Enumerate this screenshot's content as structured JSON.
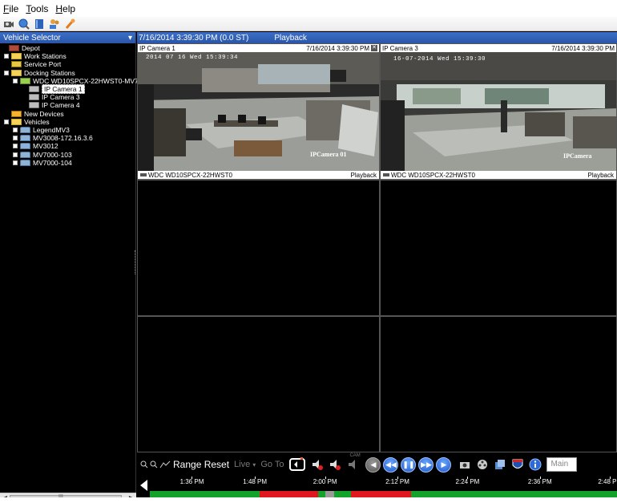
{
  "menu": {
    "items": [
      {
        "label": "File",
        "ul": "F",
        "rest": "ile"
      },
      {
        "label": "Tools",
        "ul": "T",
        "rest": "ools"
      },
      {
        "label": "Help",
        "ul": "H",
        "rest": "elp"
      }
    ]
  },
  "toolbar": {
    "icons": [
      "camera-icon",
      "globe-search-icon",
      "book-icon",
      "users-icon",
      "wrench-icon"
    ]
  },
  "left_panel": {
    "title": "Vehicle Selector",
    "pin": "▾",
    "tree": [
      {
        "label": "Depot",
        "icon": "depot",
        "level": 0,
        "exp": false
      },
      {
        "label": "Work Stations",
        "icon": "folder",
        "level": 1,
        "exp": true
      },
      {
        "label": "Service Port",
        "icon": "port",
        "level": 1,
        "exp": false
      },
      {
        "label": "Docking Stations",
        "icon": "folder",
        "level": 1,
        "exp": true
      },
      {
        "label": "WDC WD10SPCX-22HWST0-MV7",
        "icon": "station",
        "level": 2,
        "exp": true
      },
      {
        "label": "IP Camera 1",
        "icon": "cam",
        "level": 3,
        "exp": false,
        "selected": true
      },
      {
        "label": "IP Camera 3",
        "icon": "cam",
        "level": 3,
        "exp": false
      },
      {
        "label": "IP Camera 4",
        "icon": "cam",
        "level": 3,
        "exp": false
      },
      {
        "label": "New Devices",
        "icon": "newdev",
        "level": 1,
        "exp": false
      },
      {
        "label": "Vehicles",
        "icon": "folder",
        "level": 1,
        "exp": true
      },
      {
        "label": "LegendMV3",
        "icon": "veh",
        "level": 2,
        "exp": true
      },
      {
        "label": "MV3008-172.16.3.6",
        "icon": "veh",
        "level": 2,
        "exp": true
      },
      {
        "label": "MV3012",
        "icon": "veh",
        "level": 2,
        "exp": true
      },
      {
        "label": "MV7000-103",
        "icon": "veh",
        "level": 2,
        "exp": true
      },
      {
        "label": "MV7000-104",
        "icon": "veh",
        "level": 2,
        "exp": true
      }
    ],
    "scroll_mark": "III"
  },
  "main": {
    "header_time": "7/16/2014 3:39:30 PM (0.0 ST)",
    "header_mode": "Playback",
    "cells": [
      {
        "title": "IP Camera 1",
        "time": "7/16/2014 3:39:30 PM",
        "close": "✕",
        "footer_left": "WDC WD10SPCX-22HWST0",
        "footer_right": "Playback",
        "osd": "2014 07 16 Wed 15:39:34",
        "watermark": "IPCamera 01"
      },
      {
        "title": "IP Camera 3",
        "time": "7/16/2014 3:39:30 PM",
        "footer_left": "WDC WD10SPCX-22HWST0",
        "footer_right": "Playback",
        "osd": "16-07-2014 Wed 15:39:30",
        "watermark": "IPCamera"
      }
    ]
  },
  "controls": {
    "range_reset": "Range Reset",
    "live": "Live",
    "live_arrow": "▾",
    "goto": "Go To",
    "cam": "CAM",
    "main_select": "Main"
  },
  "timeline": {
    "ticks": [
      "1:36 PM",
      "1:48 PM",
      "2:00 PM",
      "2:12 PM",
      "2:24 PM",
      "2:36 PM",
      "2:48 PM"
    ],
    "colors": {
      "recorded": "#13a32a",
      "event": "#e0171e",
      "gap": "#9a9a9a"
    }
  }
}
